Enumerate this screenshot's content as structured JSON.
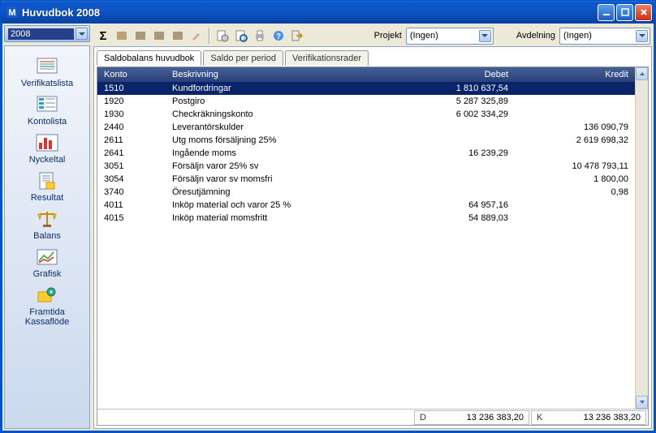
{
  "window": {
    "title": "Huvudbok 2008"
  },
  "year": {
    "value": "2008"
  },
  "sidebar": {
    "items": [
      {
        "label": "Verifikatslista"
      },
      {
        "label": "Kontolista"
      },
      {
        "label": "Nyckeltal"
      },
      {
        "label": "Resultat"
      },
      {
        "label": "Balans"
      },
      {
        "label": "Grafisk"
      },
      {
        "label": "Framtida\nKassaflöde"
      }
    ]
  },
  "toolbar": {
    "projekt_label": "Projekt",
    "projekt_value": "(Ingen)",
    "avdelning_label": "Avdelning",
    "avdelning_value": "(Ingen)"
  },
  "tabs": [
    {
      "label": "Saldobalans huvudbok"
    },
    {
      "label": "Saldo per period"
    },
    {
      "label": "Verifikationsrader"
    }
  ],
  "grid": {
    "headers": {
      "konto": "Konto",
      "beskrivning": "Beskrivning",
      "debet": "Debet",
      "kredit": "Kredit"
    },
    "rows": [
      {
        "konto": "1510",
        "beskrivning": "Kundfordringar",
        "debet": "1 810 637,54",
        "kredit": ""
      },
      {
        "konto": "1920",
        "beskrivning": "Postgiro",
        "debet": "5 287 325,89",
        "kredit": ""
      },
      {
        "konto": "1930",
        "beskrivning": "Checkräkningskonto",
        "debet": "6 002 334,29",
        "kredit": ""
      },
      {
        "konto": "2440",
        "beskrivning": "Leverantörskulder",
        "debet": "",
        "kredit": "136 090,79"
      },
      {
        "konto": "2611",
        "beskrivning": "Utg moms försäljning 25%",
        "debet": "",
        "kredit": "2 619 698,32"
      },
      {
        "konto": "2641",
        "beskrivning": "Ingående moms",
        "debet": "16 239,29",
        "kredit": ""
      },
      {
        "konto": "3051",
        "beskrivning": "Försäljn varor 25% sv",
        "debet": "",
        "kredit": "10 478 793,11"
      },
      {
        "konto": "3054",
        "beskrivning": "Försäljn varor sv momsfri",
        "debet": "",
        "kredit": "1 800,00"
      },
      {
        "konto": "3740",
        "beskrivning": "Öresutjämning",
        "debet": "",
        "kredit": "0,98"
      },
      {
        "konto": "4011",
        "beskrivning": "Inköp material och varor 25 %",
        "debet": "64 957,16",
        "kredit": ""
      },
      {
        "konto": "4015",
        "beskrivning": "Inköp material momsfritt",
        "debet": "54 889,03",
        "kredit": ""
      }
    ]
  },
  "footer": {
    "debet_key": "D",
    "debet_value": "13 236 383,20",
    "kredit_key": "K",
    "kredit_value": "13 236 383,20"
  }
}
